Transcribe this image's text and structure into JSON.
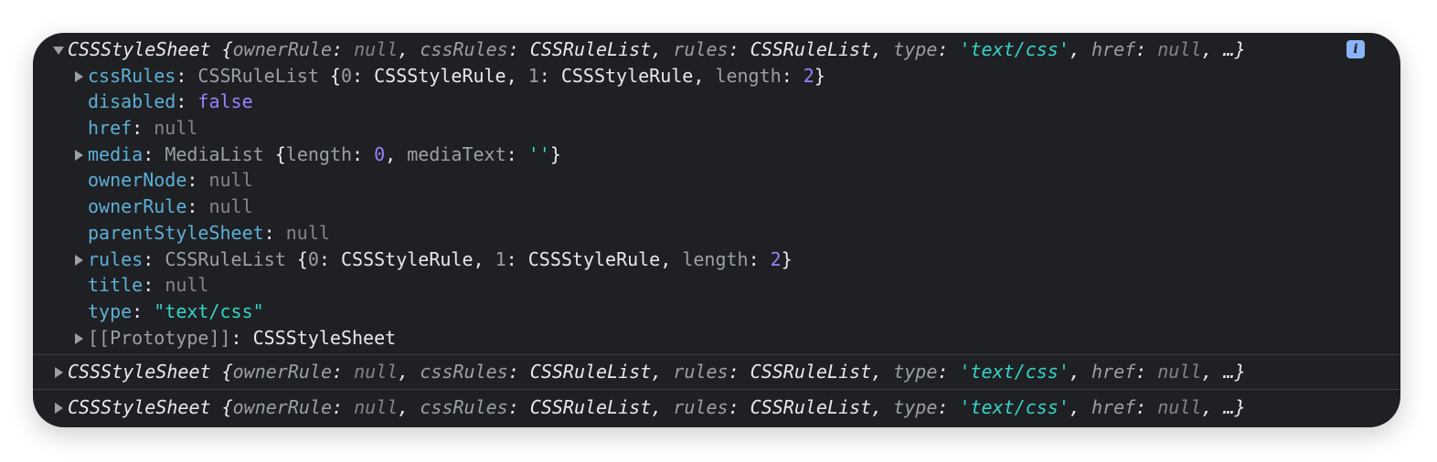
{
  "summary": {
    "class": "CSSStyleSheet",
    "owner_key": "ownerRule",
    "owner_val": "null",
    "cssrules_key": "cssRules",
    "cssrules_val": "CSSRuleList",
    "rules_key": "rules",
    "rules_val": "CSSRuleList",
    "type_key": "type",
    "type_val": "'text/css'",
    "href_key": "href",
    "href_val": "null",
    "ellipsis": "…"
  },
  "props": {
    "cssRules": {
      "key": "cssRules",
      "cls": "CSSRuleList",
      "k0": "0",
      "v0": "CSSStyleRule",
      "k1": "1",
      "v1": "CSSStyleRule",
      "lenkey": "length",
      "len": "2"
    },
    "disabled": {
      "key": "disabled",
      "val": "false"
    },
    "href": {
      "key": "href",
      "val": "null"
    },
    "media": {
      "key": "media",
      "cls": "MediaList",
      "lenkey": "length",
      "len": "0",
      "mtkey": "mediaText",
      "mt": "''"
    },
    "ownerNode": {
      "key": "ownerNode",
      "val": "null"
    },
    "ownerRule": {
      "key": "ownerRule",
      "val": "null"
    },
    "parentStyleSheet": {
      "key": "parentStyleSheet",
      "val": "null"
    },
    "rules": {
      "key": "rules",
      "cls": "CSSRuleList",
      "k0": "0",
      "v0": "CSSStyleRule",
      "k1": "1",
      "v1": "CSSStyleRule",
      "lenkey": "length",
      "len": "2"
    },
    "title": {
      "key": "title",
      "val": "null"
    },
    "type": {
      "key": "type",
      "val": "\"text/css\""
    },
    "proto": {
      "key": "[[Prototype]]",
      "val": "CSSStyleSheet"
    }
  },
  "info_icon": {
    "name": "info-icon",
    "glyph": "i"
  }
}
